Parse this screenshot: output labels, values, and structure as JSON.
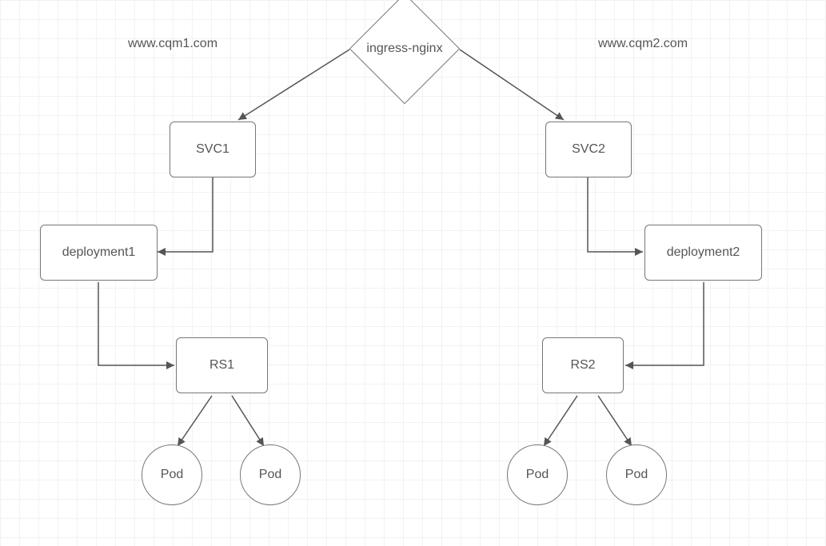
{
  "labels": {
    "left_domain": "www.cqm1.com",
    "right_domain": "www.cqm2.com"
  },
  "nodes": {
    "ingress": "ingress-nginx",
    "svc1": "SVC1",
    "svc2": "SVC2",
    "dep1": "deployment1",
    "dep2": "deployment2",
    "rs1": "RS1",
    "rs2": "RS2",
    "pod1a": "Pod",
    "pod1b": "Pod",
    "pod2a": "Pod",
    "pod2b": "Pod"
  }
}
